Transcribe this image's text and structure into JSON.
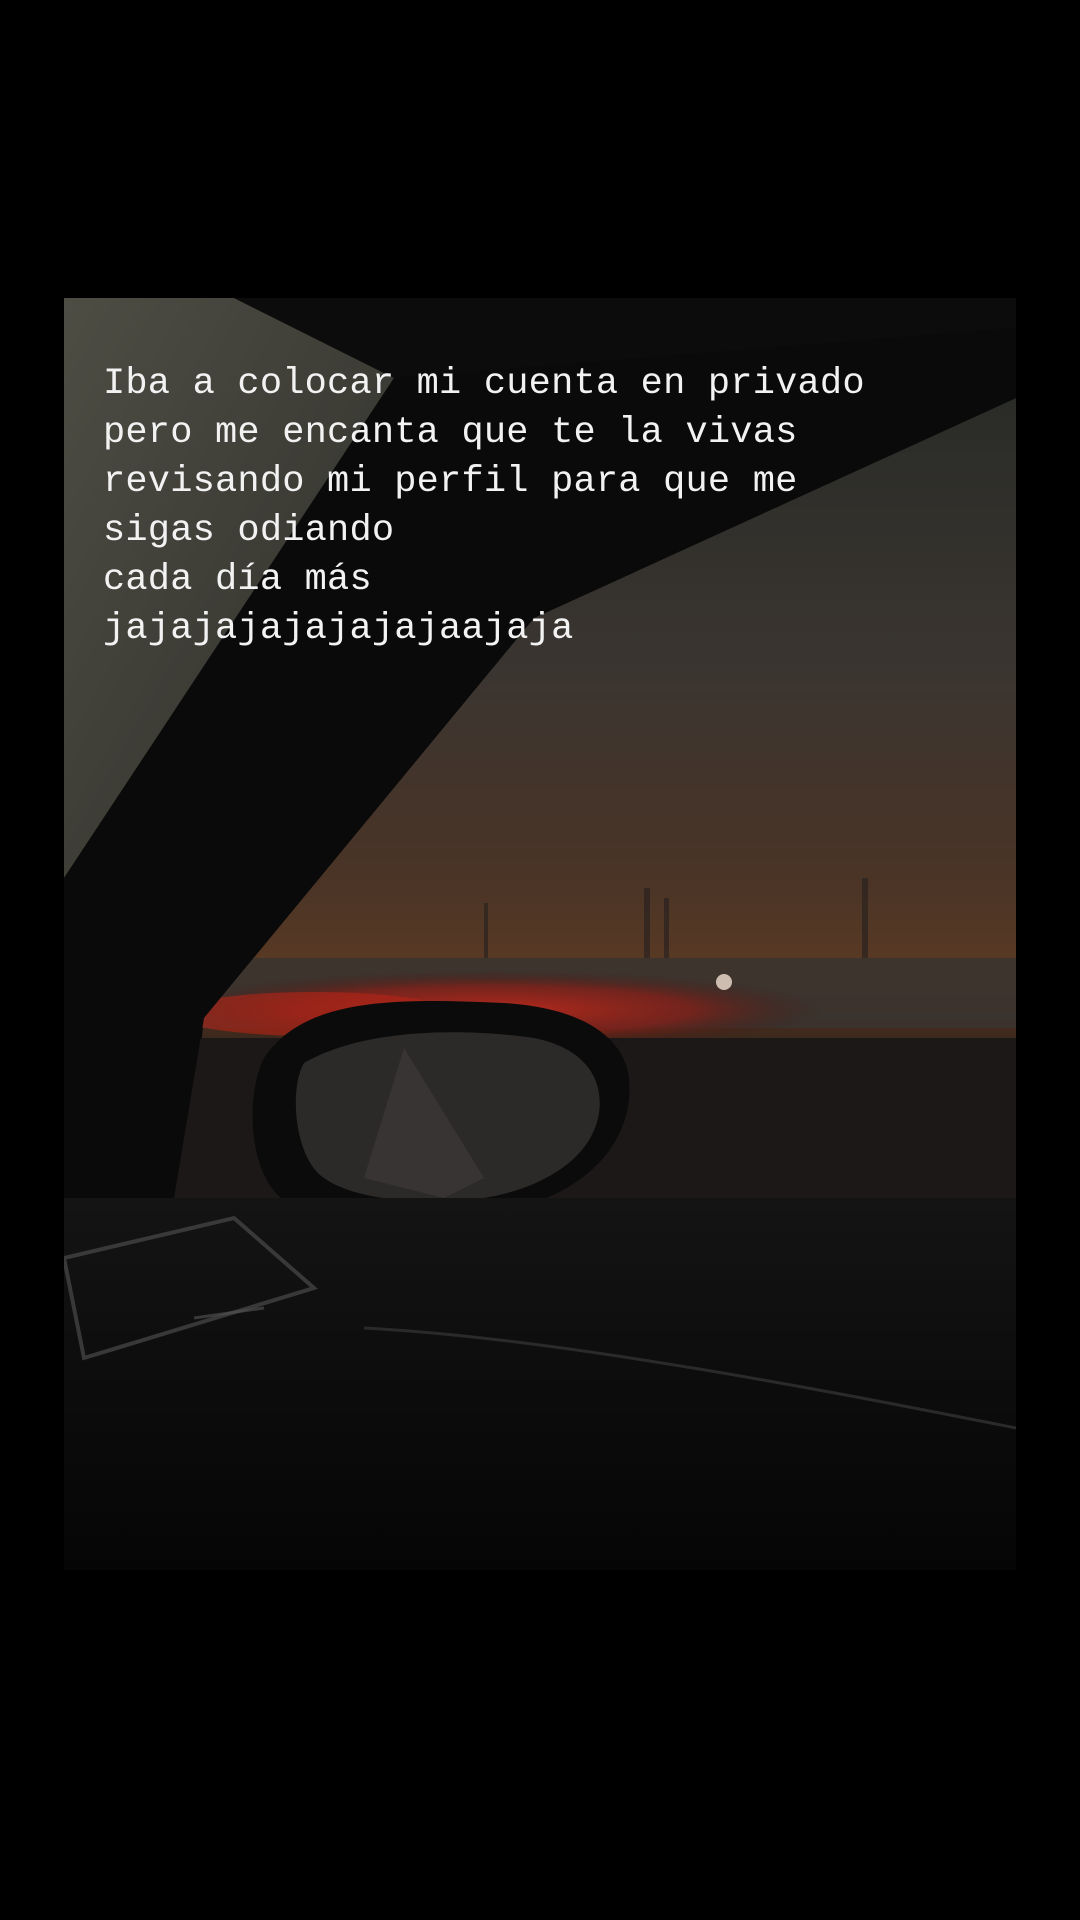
{
  "story": {
    "caption_lines": [
      "Iba a colocar mi cuenta en privado",
      "pero me encanta que te la vivas",
      "revisando mi perfil para que me",
      "sigas odiando",
      "cada día más",
      "jajajajajajajajaajaja"
    ]
  }
}
